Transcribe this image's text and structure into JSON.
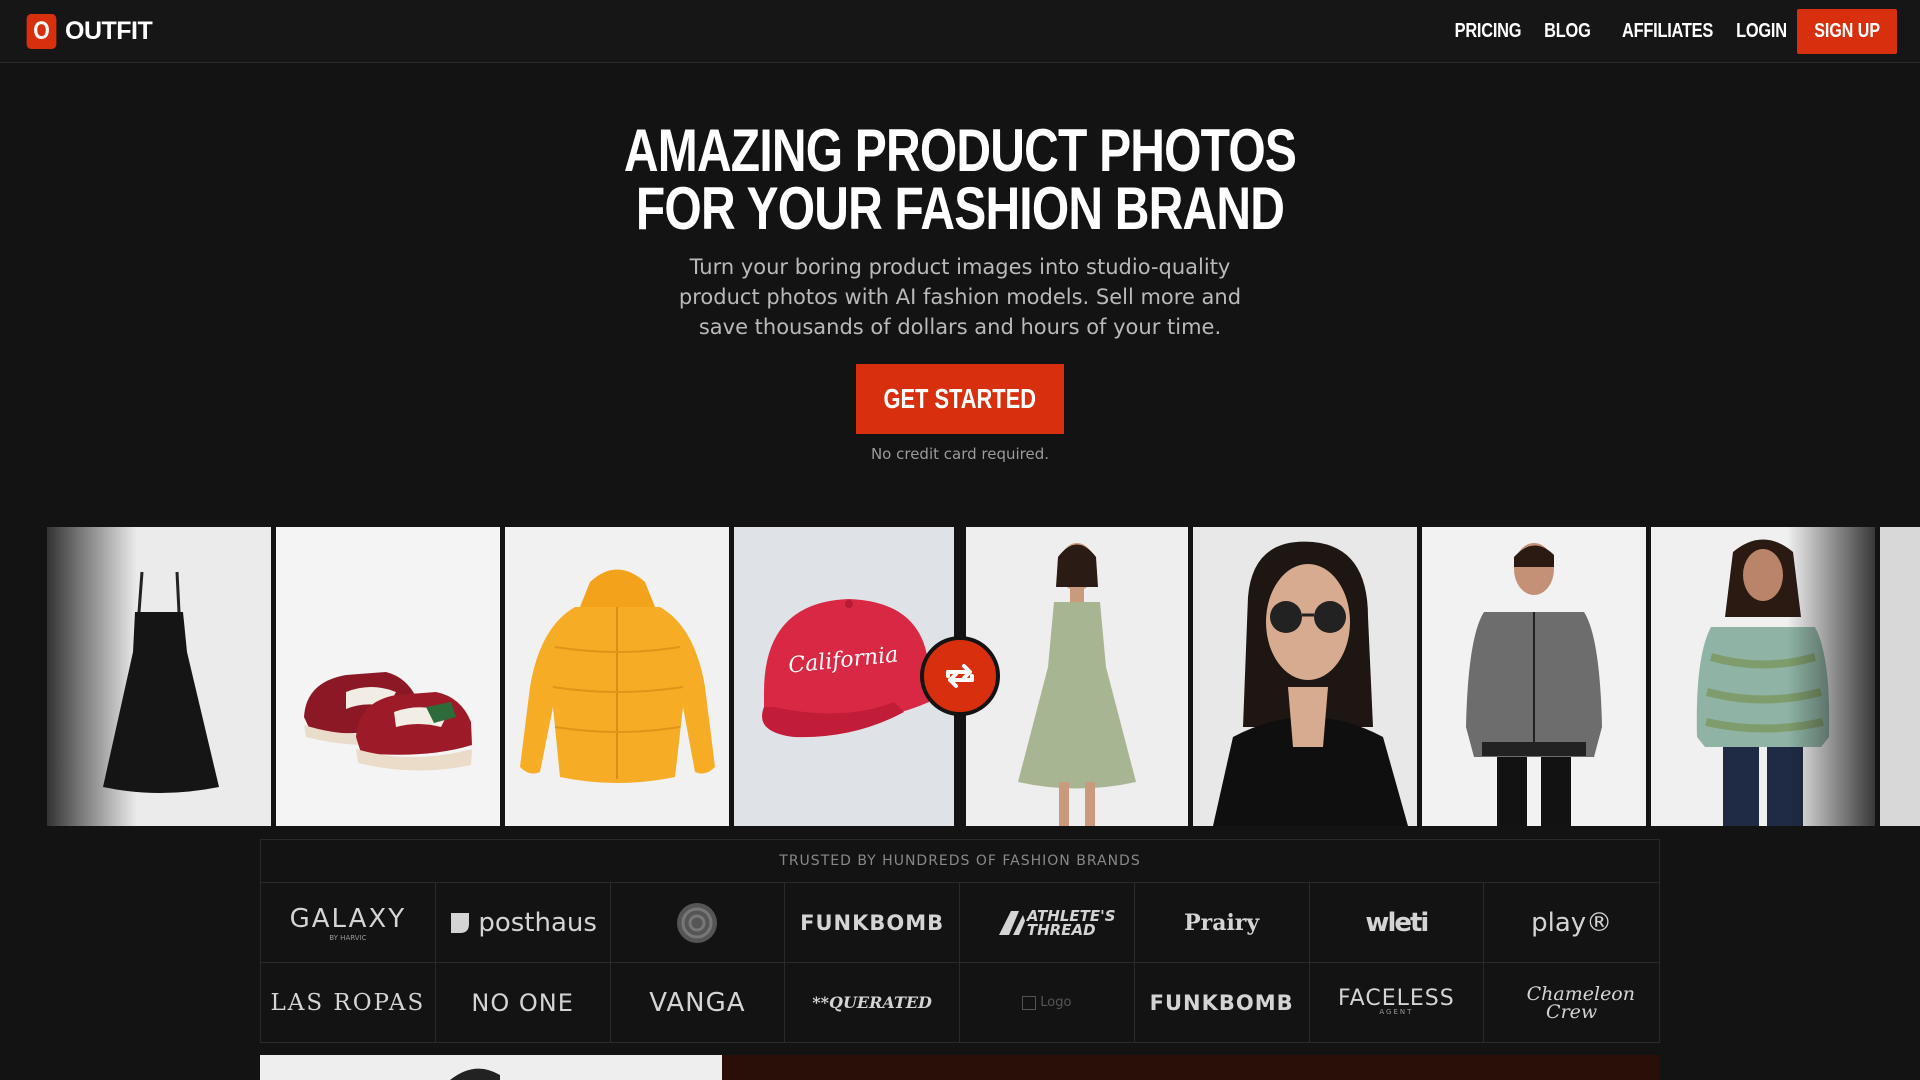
{
  "nav": {
    "logo_letter": "O",
    "logo_text": "OUTFIT",
    "links": [
      "PRICING",
      "BLOG",
      "AFFILIATES",
      "LOGIN"
    ],
    "signup_label": "SIGN UP"
  },
  "hero": {
    "title_line1": "AMAZING PRODUCT PHOTOS",
    "title_line2": "FOR YOUR FASHION BRAND",
    "subtitle": "Turn your boring product images into studio-quality product photos with AI fashion models. Sell more and save thousands of dollars and hours of your time.",
    "cta_label": "GET STARTED",
    "note": "No credit card required."
  },
  "strip": {
    "before": [
      "black-dress",
      "red-sneakers",
      "yellow-puffer-jacket",
      "red-cap"
    ],
    "after": [
      "model-green-dress",
      "model-sunglasses-blazer",
      "model-grey-jacket",
      "model-green-sweater"
    ],
    "cap_text": "California",
    "swap_icon": "swap-arrows-icon"
  },
  "brands": {
    "heading": "TRUSTED BY HUNDREDS OF FASHION BRANDS",
    "row1": [
      "GALAXY",
      "posthaus",
      "",
      "FUNKBOMB",
      "ATHLETE'S THREAD",
      "Prairy",
      "wleti",
      "play®"
    ],
    "row2": [
      "LAS ROPAS",
      "NO ONE",
      "VANGA",
      "**QUERATED",
      "",
      "FUNKBOMB",
      "FACELESS",
      "Chameleon Crew"
    ],
    "galaxy_sub": "BY HARVIC",
    "faceless_sub": "AGENT",
    "alt_text": "Logo"
  },
  "colors": {
    "background": "#131313",
    "accent": "#d8300f",
    "text_muted": "#b9b9b9"
  }
}
